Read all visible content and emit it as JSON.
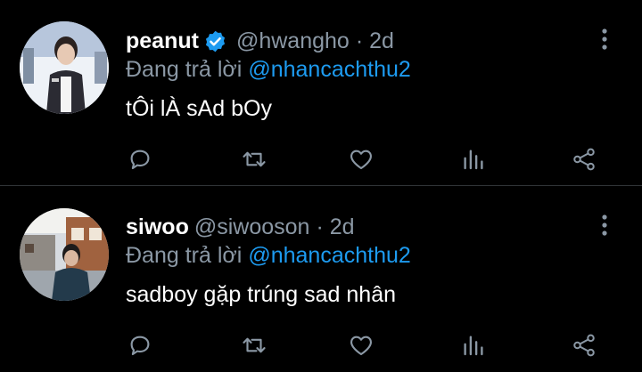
{
  "colors": {
    "background": "#000000",
    "text": "#ffffff",
    "muted": "#8b98a5",
    "accent": "#1d9bf0",
    "divider": "#2f3336",
    "icon": "#8b98a5"
  },
  "tweets": [
    {
      "name": "peanut",
      "verified": true,
      "handle": "@hwangho",
      "dot": "·",
      "time": "2d",
      "reply_prefix": "Đang trả lời",
      "reply_to": "@nhancachthu2",
      "text": "tÔi lÀ sAd bOy",
      "icons": [
        "avatar",
        "verified-badge-icon",
        "more-vertical-icon",
        "reply-icon",
        "retweet-icon",
        "like-icon",
        "stats-icon",
        "share-icon"
      ]
    },
    {
      "name": "siwoo",
      "verified": false,
      "handle": "@siwooson",
      "dot": "·",
      "time": "2d",
      "reply_prefix": "Đang trả lời",
      "reply_to": "@nhancachthu2",
      "text": "sadboy gặp trúng sad nhân",
      "icons": [
        "avatar",
        "more-vertical-icon",
        "reply-icon",
        "retweet-icon",
        "like-icon",
        "stats-icon",
        "share-icon"
      ]
    }
  ]
}
